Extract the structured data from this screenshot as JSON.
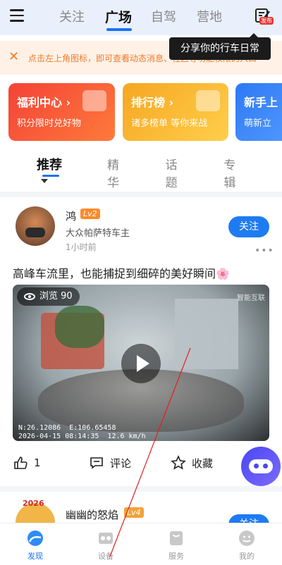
{
  "header": {
    "tabs": [
      {
        "label": "关注"
      },
      {
        "label": "广场",
        "active": true
      },
      {
        "label": "自驾"
      },
      {
        "label": "营地"
      }
    ],
    "publish_badge": "发布"
  },
  "tooltip": "分享你的行车日常",
  "notice": {
    "text": "点击左上角图标，即可查看动态消息、社区等功能权限的入口"
  },
  "cards": [
    {
      "title": "福利中心 ›",
      "subtitle": "积分限时兑好物"
    },
    {
      "title": "排行榜 ›",
      "subtitle": "诸多榜单  等你来战"
    },
    {
      "title": "新手上",
      "subtitle": "萌新立"
    }
  ],
  "subtabs": [
    "推荐",
    "精华",
    "话题",
    "专辑"
  ],
  "post": {
    "user": "鸿",
    "level": "Lv2",
    "owner": "大众帕萨特车主",
    "time": "1小时前",
    "follow": "关注",
    "more": "•••",
    "text": "高峰车流里，也能捕捉到细碎的美好瞬间🌸",
    "views": "浏览 90",
    "watermark": "智能互联",
    "osd_line1": "N:26.12086  E:106.65458",
    "osd_line2": "2026-04-15 08:14:35  12.6 km/h",
    "likes": "1",
    "comment": "评论",
    "favorite": "收藏"
  },
  "post2": {
    "user": "幽幽的怒焰",
    "level": "Lv4",
    "avatar_text": "2026",
    "follow": "关注"
  },
  "bottom_nav": [
    {
      "label": "发现",
      "active": true
    },
    {
      "label": "设备"
    },
    {
      "label": "服务"
    },
    {
      "label": "我的"
    }
  ],
  "colors": {
    "accent": "#1a72f0",
    "notice": "#f07a2a"
  }
}
